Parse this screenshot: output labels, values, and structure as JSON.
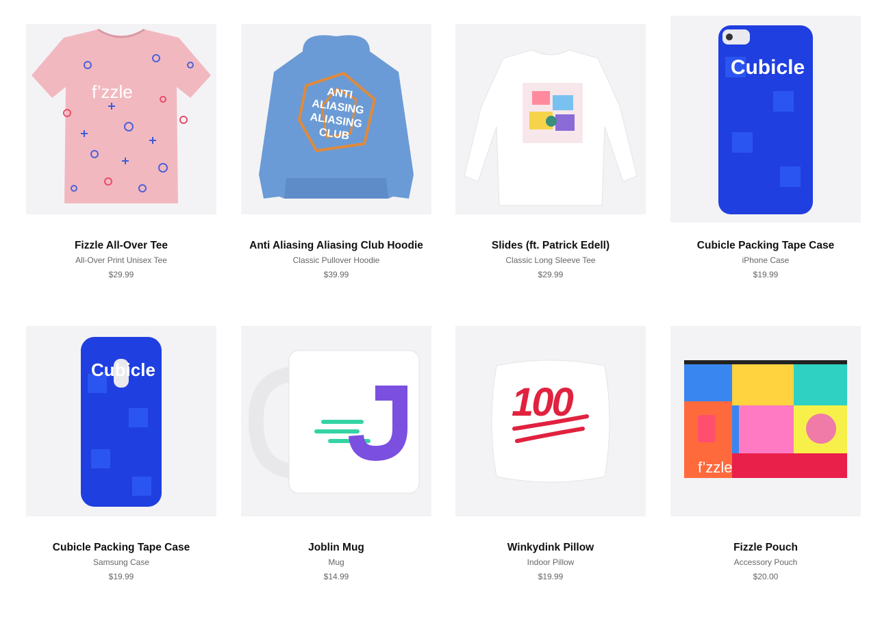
{
  "products": [
    {
      "title": "Fizzle All-Over Tee",
      "subtitle": "All-Over Print Unisex Tee",
      "price": "$29.99",
      "image_icon": "pink-patterned-tshirt",
      "image_text": "f’zzle"
    },
    {
      "title": "Anti Aliasing Aliasing Club Hoodie",
      "subtitle": "Classic Pullover Hoodie",
      "price": "$39.99",
      "image_icon": "blue-hoodie",
      "image_text": "ANTI ALIASING ALIASING CLUB"
    },
    {
      "title": "Slides (ft. Patrick Edell)",
      "subtitle": "Classic Long Sleeve Tee",
      "price": "$29.99",
      "image_icon": "white-long-sleeve-tee"
    },
    {
      "title": "Cubicle Packing Tape Case",
      "subtitle": "iPhone Case",
      "price": "$19.99",
      "image_icon": "blue-phone-case",
      "image_text": "Cubicle"
    },
    {
      "title": "Cubicle Packing Tape Case",
      "subtitle": "Samsung Case",
      "price": "$19.99",
      "image_icon": "blue-phone-case",
      "image_text": "Cubicle"
    },
    {
      "title": "Joblin Mug",
      "subtitle": "Mug",
      "price": "$14.99",
      "image_icon": "white-mug-purple-j",
      "image_text": "J"
    },
    {
      "title": "Winkydink Pillow",
      "subtitle": "Indoor Pillow",
      "price": "$19.99",
      "image_icon": "white-pillow-100",
      "image_text": "100"
    },
    {
      "title": "Fizzle Pouch",
      "subtitle": "Accessory Pouch",
      "price": "$20.00",
      "image_icon": "colorful-zipper-pouch",
      "image_text": "f’zzle"
    }
  ],
  "colors": {
    "thumb_bg": "#f3f3f5",
    "tee_pink": "#f2b8c0",
    "hoodie_blue": "#6b9bd6",
    "case_blue": "#1f3fe0",
    "mug_purple": "#7b4fe0",
    "mug_green": "#34d3a4",
    "pillow_red": "#e0223f"
  }
}
